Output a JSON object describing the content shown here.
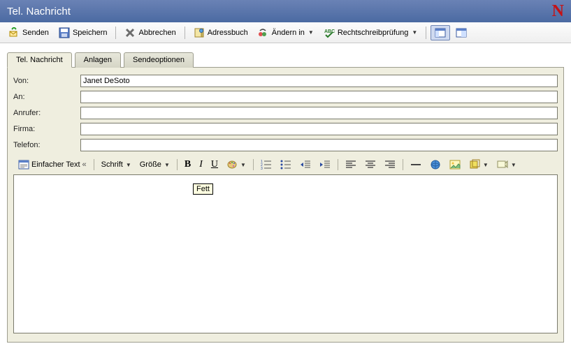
{
  "window": {
    "title": "Tel. Nachricht",
    "brand": "N"
  },
  "toolbar": {
    "send": "Senden",
    "save": "Speichern",
    "cancel": "Abbrechen",
    "addressbook": "Adressbuch",
    "changein": "Ändern in",
    "spellcheck": "Rechtschreibprüfung"
  },
  "tabs": {
    "message": "Tel. Nachricht",
    "attachments": "Anlagen",
    "sendoptions": "Sendeoptionen"
  },
  "form": {
    "from_label": "Von:",
    "from_value": "Janet DeSoto",
    "to_label": "An:",
    "to_value": "",
    "caller_label": "Anrufer:",
    "caller_value": "",
    "company_label": "Firma:",
    "company_value": "",
    "phone_label": "Telefon:",
    "phone_value": ""
  },
  "editor": {
    "mode_label": "Einfacher Text",
    "mode_chevrons": "«",
    "font_label": "Schrift",
    "size_label": "Größe",
    "tooltip": "Fett"
  }
}
